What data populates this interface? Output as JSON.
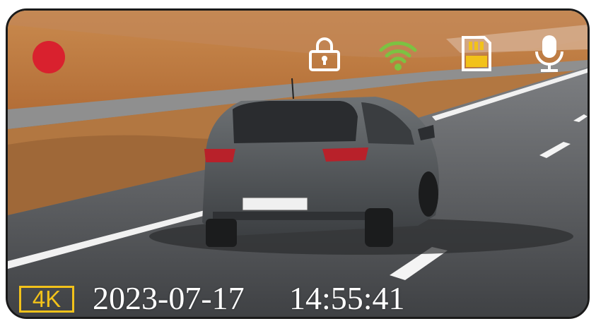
{
  "recording": {
    "icon": "record-dot-icon",
    "color": "#d9212e"
  },
  "status_icons": [
    {
      "name": "lock-icon",
      "color": "#ffffff"
    },
    {
      "name": "wifi-icon",
      "color": "#7cc242"
    },
    {
      "name": "sd-card-icon",
      "color": "#ffffff"
    },
    {
      "name": "microphone-icon",
      "color": "#ffffff"
    }
  ],
  "overlay": {
    "resolution": "4K",
    "resolution_color": "#f2c21a",
    "date": "2023-07-17",
    "time": "14:55:41"
  }
}
